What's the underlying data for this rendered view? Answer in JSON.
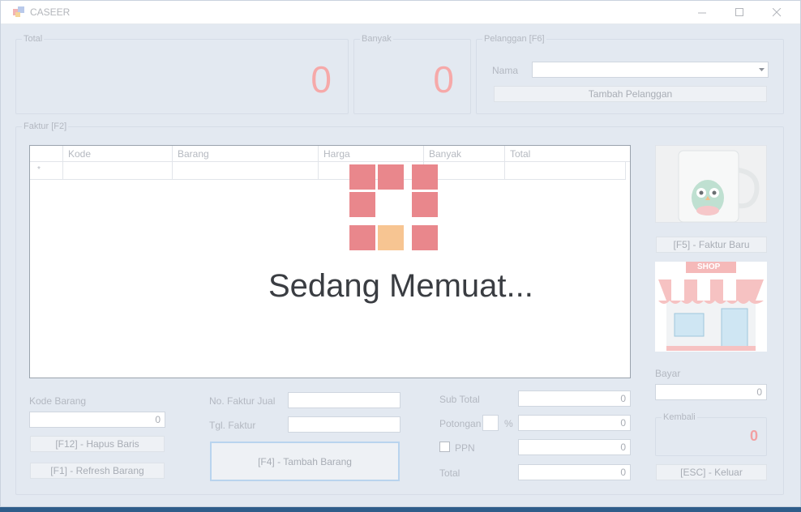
{
  "window": {
    "title": "CASEER"
  },
  "total_group": {
    "label": "Total",
    "value": "0"
  },
  "banyak_group": {
    "label": "Banyak",
    "value": "0"
  },
  "pelanggan_group": {
    "label": "Pelanggan [F6]",
    "nama_label": "Nama",
    "nama_value": "",
    "tambah_button": "Tambah Pelanggan"
  },
  "faktur_group": {
    "label": "Faktur [F2]",
    "grid": {
      "columns": [
        "Kode",
        "Barang",
        "Harga",
        "Banyak",
        "Total"
      ],
      "new_row_marker": "*"
    }
  },
  "loading": {
    "text": "Sedang Memuat..."
  },
  "kode_barang": {
    "label": "Kode Barang",
    "value": "0",
    "hapus_button": "[F12] - Hapus Baris",
    "refresh_button": "[F1] - Refresh Barang"
  },
  "faktur_info": {
    "no_label": "No. Faktur Jual",
    "no_value": "",
    "tgl_label": "Tgl. Faktur",
    "tgl_value": "",
    "tambah_barang_button": "[F4] - Tambah Barang"
  },
  "totals": {
    "subtotal_label": "Sub Total",
    "subtotal_value": "0",
    "potongan_label": "Potongan",
    "potongan_percent_value": "",
    "percent_sign": "%",
    "potongan_value": "0",
    "ppn_label": "PPN",
    "ppn_value": "0",
    "total_label": "Total",
    "total_value": "0"
  },
  "right_panel": {
    "faktur_baru_button": "[F5] - Faktur Baru",
    "shop_sign": "SHOP",
    "bayar_label": "Bayar",
    "bayar_value": "0",
    "kembali_label": "Kembali",
    "kembali_value": "0",
    "keluar_button": "[ESC] - Keluar"
  },
  "colors": {
    "big_number": "#f6a9a9",
    "loader_square": "#e9878c",
    "loader_active": "#f7c592",
    "kembali_value": "#f2a0a3"
  }
}
